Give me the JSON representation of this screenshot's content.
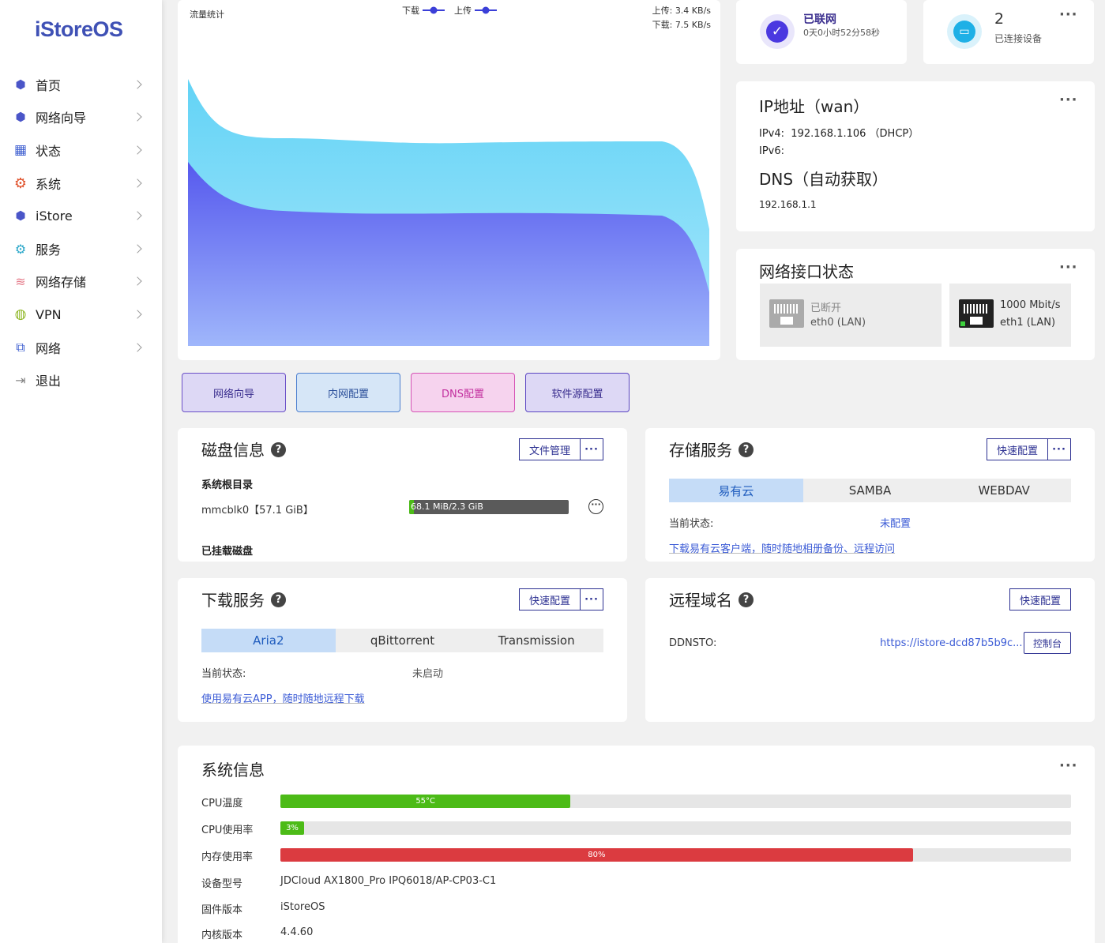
{
  "app": {
    "logo": "iStoreOS"
  },
  "sidebar": {
    "items": [
      {
        "label": "首页",
        "icon": "cube-icon"
      },
      {
        "label": "网络向导",
        "icon": "cube-icon"
      },
      {
        "label": "状态",
        "icon": "grid-icon"
      },
      {
        "label": "系统",
        "icon": "gear-icon"
      },
      {
        "label": "iStore",
        "icon": "cube-icon"
      },
      {
        "label": "服务",
        "icon": "gears-icon"
      },
      {
        "label": "网络存储",
        "icon": "database-icon"
      },
      {
        "label": "VPN",
        "icon": "globe-icon"
      },
      {
        "label": "网络",
        "icon": "network-icon"
      },
      {
        "label": "退出",
        "icon": "logout-icon"
      }
    ]
  },
  "traffic": {
    "title": "流量统计",
    "legend_download": "下载",
    "legend_upload": "上传",
    "upload_label": "上传:",
    "upload_value": "3.4 KB/s",
    "download_label": "下载:",
    "download_value": "7.5 KB/s",
    "colors": {
      "download": "#5b63f0",
      "upload": "#6fd8f5"
    }
  },
  "quick_buttons": [
    {
      "label": "网络向导",
      "bg": "#ddd8f5",
      "border": "#6a4fc7",
      "color": "#3b2f8f"
    },
    {
      "label": "内网配置",
      "bg": "#d6e6f7",
      "border": "#4d7fcf",
      "color": "#2b4f9a"
    },
    {
      "label": "DNS配置",
      "bg": "#f6d3ee",
      "border": "#d552b5",
      "color": "#c3309f"
    },
    {
      "label": "软件源配置",
      "bg": "#ddd8f5",
      "border": "#5a45c2",
      "color": "#3b2f8f"
    }
  ],
  "status_net": {
    "title": "已联网",
    "detail": "0天0小时52分58秒"
  },
  "status_dev": {
    "count": "2",
    "label": "已连接设备"
  },
  "ip": {
    "title": "IP地址（wan）",
    "ipv4_label": "IPv4:",
    "ipv4_value": "192.168.1.106 （DHCP）",
    "ipv6_label": "IPv6:",
    "dns_title": "DNS（自动获取）",
    "dns_value": "192.168.1.1"
  },
  "interfaces": {
    "title": "网络接口状态",
    "ports": [
      {
        "status": "已断开",
        "name": "eth0 (LAN)"
      },
      {
        "status": "1000 Mbit/s",
        "name": "eth1 (LAN)"
      }
    ]
  },
  "disk": {
    "title": "磁盘信息",
    "btn_files": "文件管理",
    "root_label": "系统根目录",
    "device": "mmcblk0【57.1 GiB】",
    "usage_text": "68.1 MiB/2.3 GiB",
    "usage_fraction": 0.03,
    "mounted_label": "已挂载磁盘"
  },
  "storage": {
    "title": "存储服务",
    "btn_quick": "快速配置",
    "tabs": [
      "易有云",
      "SAMBA",
      "WEBDAV"
    ],
    "status_label": "当前状态:",
    "status_value": "未配置",
    "link": "下载易有云客户端，随时随地相册备份、远程访问"
  },
  "download": {
    "title": "下载服务",
    "btn_quick": "快速配置",
    "tabs": [
      "Aria2",
      "qBittorrent",
      "Transmission"
    ],
    "status_label": "当前状态:",
    "status_value": "未启动",
    "link": "使用易有云APP，随时随地远程下载"
  },
  "remote": {
    "title": "远程域名",
    "btn_quick": "快速配置",
    "ddnsto_label": "DDNSTO:",
    "ddnsto_url": "https://istore-dcd87b5b9c...",
    "console_btn": "控制台"
  },
  "sysinfo": {
    "title": "系统信息",
    "cpu_temp_label": "CPU温度",
    "cpu_temp_value": "55°C",
    "cpu_temp_fraction": 0.367,
    "cpu_usage_label": "CPU使用率",
    "cpu_usage_value": "3%",
    "cpu_usage_fraction": 0.03,
    "mem_label": "内存使用率",
    "mem_value": "80%",
    "mem_fraction": 0.8,
    "model_label": "设备型号",
    "model_value": "JDCloud AX1800_Pro IPQ6018/AP-CP03-C1",
    "firmware_label": "固件版本",
    "firmware_value": "iStoreOS",
    "kernel_label": "内核版本",
    "kernel_value": "4.4.60",
    "colors": {
      "temp": "#4cbb17",
      "cpu": "#4cbb17",
      "mem": "#db3b40"
    }
  }
}
